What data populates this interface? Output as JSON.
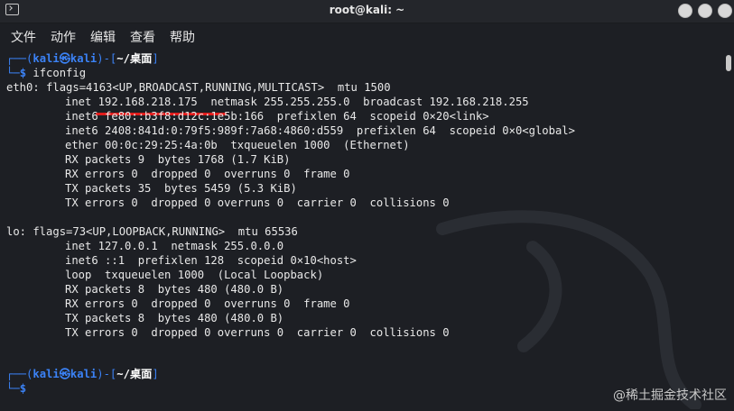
{
  "window": {
    "title": "root@kali: ~",
    "app_icon": "terminal-icon"
  },
  "menu": [
    "文件",
    "动作",
    "编辑",
    "查看",
    "帮助"
  ],
  "prompt": {
    "dash_open": "┌──(",
    "user": "kali㉿kali",
    "mid": ")-[",
    "dir": "~/桌面",
    "close": "]",
    "dash_second": "└─",
    "dollar": "$"
  },
  "command": "ifconfig",
  "output": {
    "eth0": {
      "header": "eth0: flags=4163<UP,BROADCAST,RUNNING,MULTICAST>  mtu 1500",
      "lines": [
        "inet 192.168.218.175  netmask 255.255.255.0  broadcast 192.168.218.255",
        "inet6 fe80::b3f8:d12c:1e5b:166  prefixlen 64  scopeid 0×20<link>",
        "inet6 2408:841d:0:79f5:989f:7a68:4860:d559  prefixlen 64  scopeid 0×0<global>",
        "ether 00:0c:29:25:4a:0b  txqueuelen 1000  (Ethernet)",
        "RX packets 9  bytes 1768 (1.7 KiB)",
        "RX errors 0  dropped 0  overruns 0  frame 0",
        "TX packets 35  bytes 5459 (5.3 KiB)",
        "TX errors 0  dropped 0 overruns 0  carrier 0  collisions 0"
      ]
    },
    "lo": {
      "header": "lo: flags=73<UP,LOOPBACK,RUNNING>  mtu 65536",
      "lines": [
        "inet 127.0.0.1  netmask 255.0.0.0",
        "inet6 ::1  prefixlen 128  scopeid 0×10<host>",
        "loop  txqueuelen 1000  (Local Loopback)",
        "RX packets 8  bytes 480 (480.0 B)",
        "RX errors 0  dropped 0  overruns 0  frame 0",
        "TX packets 8  bytes 480 (480.0 B)",
        "TX errors 0  dropped 0 overruns 0  carrier 0  collisions 0"
      ]
    }
  },
  "watermark_text": "@稀土掘金技术社区",
  "colors": {
    "background": "#1d1f24",
    "prompt_blue": "#3b82f6",
    "text": "#e8e8e8",
    "highlight_underline": "#e21b1b"
  }
}
